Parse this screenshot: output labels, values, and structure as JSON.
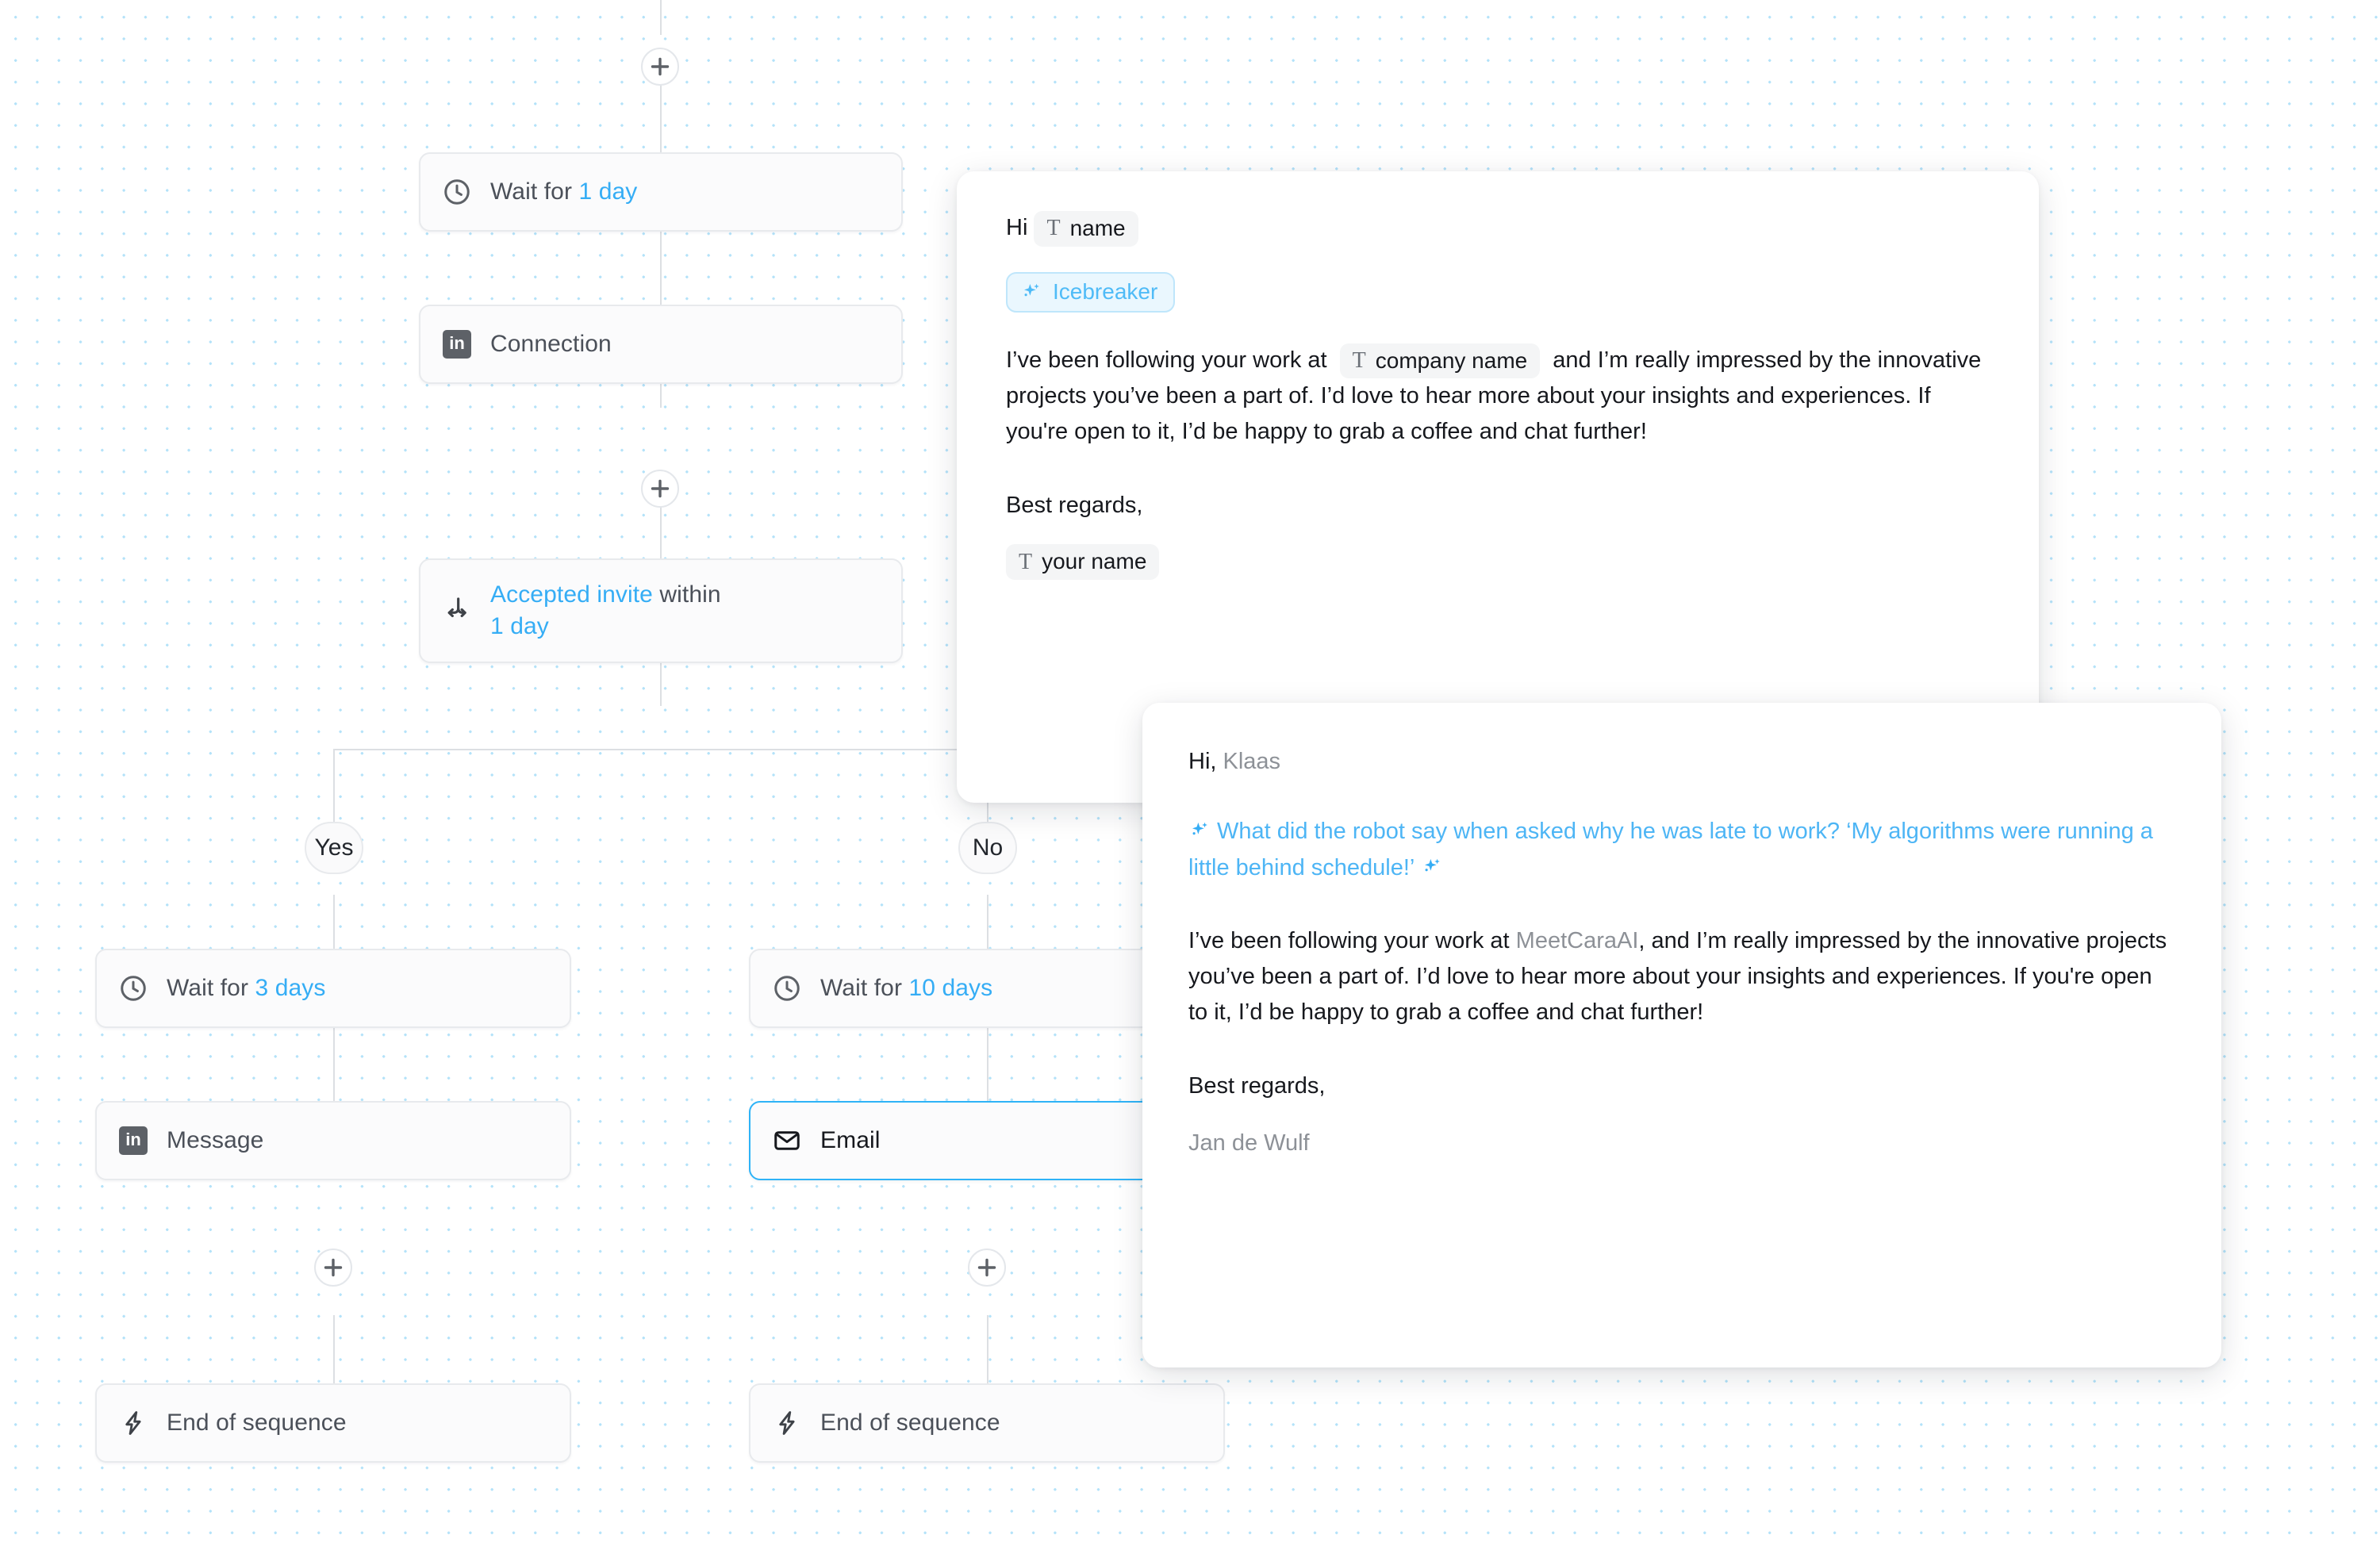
{
  "canvas": {
    "grid_dot_color": "#b3e2f9",
    "background": "#ffffff",
    "line_color": "#dcdfe3"
  },
  "flow": {
    "add_step_label": "+",
    "nodes": [
      {
        "id": "wait-1-day",
        "icon": "clock-icon",
        "label_prefix": "Wait for ",
        "label_accent": "1 day",
        "label_suffix": ""
      },
      {
        "id": "connection",
        "icon": "linkedin-icon",
        "label_prefix": "Connection",
        "label_accent": "",
        "label_suffix": ""
      },
      {
        "id": "accepted-invite",
        "icon": "branch-icon",
        "label_prefix": "",
        "label_accent": "Accepted invite",
        "label_mid": " within ",
        "label_accent2": "1 day"
      },
      {
        "id": "wait-3-days",
        "icon": "clock-icon",
        "label_prefix": "Wait for ",
        "label_accent": "3 days",
        "label_suffix": ""
      },
      {
        "id": "message",
        "icon": "linkedin-icon",
        "label_prefix": "Message",
        "label_accent": "",
        "label_suffix": ""
      },
      {
        "id": "end-left",
        "icon": "bolt-icon",
        "label_prefix": "End of sequence",
        "label_accent": "",
        "label_suffix": ""
      },
      {
        "id": "wait-10-days",
        "icon": "clock-icon",
        "label_prefix": "Wait for ",
        "label_accent": "10 days",
        "label_suffix": ""
      },
      {
        "id": "email",
        "icon": "envelope-icon",
        "label_prefix": "Email",
        "label_accent": "",
        "label_suffix": "",
        "selected": true
      },
      {
        "id": "end-right",
        "icon": "bolt-icon",
        "label_prefix": "End of sequence",
        "label_accent": "",
        "label_suffix": ""
      }
    ],
    "branch_yes_label": "Yes",
    "branch_no_label": "No",
    "accent_color": "#35adf5",
    "selected_border_color": "#2eb3f7"
  },
  "composer": {
    "greeting": "Hi",
    "name_chip": "name",
    "company_chip": "company name",
    "signature_chip": "your name",
    "icebreaker_label": "Icebreaker",
    "body_part1": "I’ve been following your work at",
    "body_part2": "and I’m really impressed by the innovative projects you’ve been a part of. I’d love to hear more about your insights and experiences. If you're open to it, I’d be happy to grab a coffee and chat further!",
    "sign_off": "Best regards,"
  },
  "preview": {
    "greeting_prefix": "Hi, ",
    "recipient_name": "Klaas",
    "icebreaker_text": "What did the robot say when asked why he was late to work? ‘My algorithms were running a little behind schedule!’",
    "body_prefix": "I’ve been following your work at ",
    "company": "MeetCaraAI",
    "body_rest": ", and I’m really impressed by the innovative projects you’ve been a part of. I’d love to hear more about your insights and experiences. If you're open to it, I’d be happy to grab a coffee and chat further!",
    "sign_off": "Best regards,",
    "sender_name": "Jan de Wulf"
  }
}
